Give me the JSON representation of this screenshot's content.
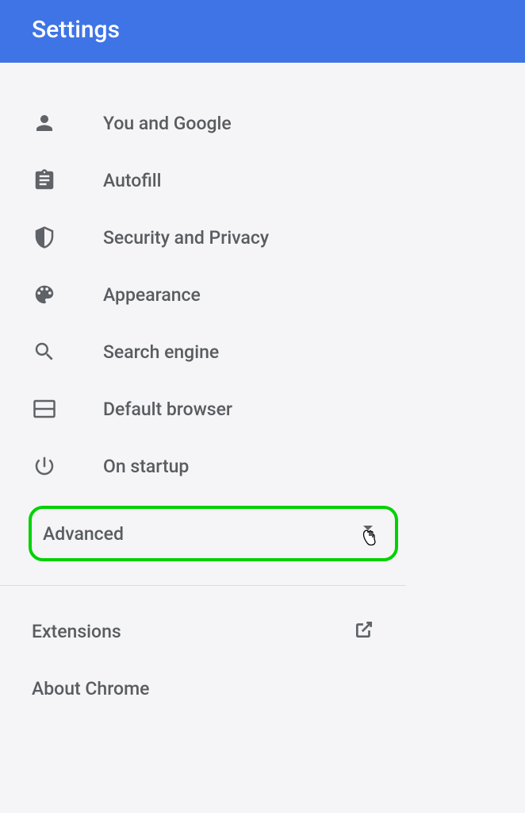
{
  "header": {
    "title": "Settings"
  },
  "menu": {
    "items": [
      {
        "icon": "person",
        "label": "You and Google"
      },
      {
        "icon": "clipboard",
        "label": "Autofill"
      },
      {
        "icon": "shield",
        "label": "Security and Privacy"
      },
      {
        "icon": "palette",
        "label": "Appearance"
      },
      {
        "icon": "search",
        "label": "Search engine"
      },
      {
        "icon": "browser",
        "label": "Default browser"
      },
      {
        "icon": "power",
        "label": "On startup"
      }
    ]
  },
  "advanced": {
    "label": "Advanced"
  },
  "footer": {
    "items": [
      {
        "label": "Extensions",
        "external": true
      },
      {
        "label": "About Chrome",
        "external": false
      }
    ]
  }
}
